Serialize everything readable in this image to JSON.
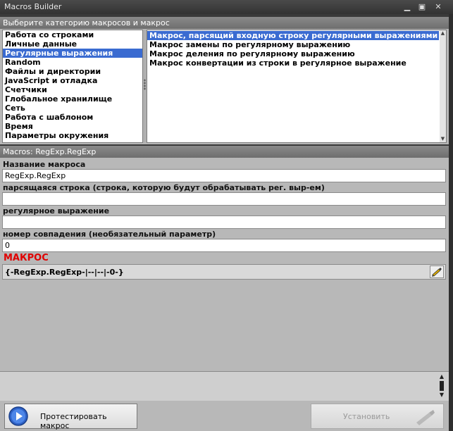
{
  "window": {
    "title": "Macros Builder"
  },
  "categories_panel": {
    "header": "Выберите категорию макросов и макрос",
    "categories": [
      "Работа со строками",
      "Личные данные",
      "Регулярные выражения",
      "Random",
      "Файлы и директории",
      "JavaScript и отладка",
      "Счетчики",
      "Глобальное хранилище",
      "Сеть",
      "Работа с шаблоном",
      "Время",
      "Параметры окружения"
    ],
    "selected_category": "Регулярные выражения",
    "macros": [
      "Макрос, парсящий входную строку регулярными выражениями",
      "Макрос замены по регулярному выражению",
      "Макрос деления по регулярному выражению",
      "Макрос конвертации из строки в регулярное выражение"
    ],
    "selected_macro": "Макрос, парсящий входную строку регулярными выражениями"
  },
  "macro_panel": {
    "header": "Macros: RegExp.RegExp",
    "fields": [
      {
        "label": "Название макроса",
        "value": "RegExp.RegExp"
      },
      {
        "label": "парсящаяся строка (строка, которую будут обрабатывать рег. выр-ем)",
        "value": ""
      },
      {
        "label": "регулярное выражение",
        "value": ""
      },
      {
        "label": "номер совпадения (необязательный параметр)",
        "value": "0"
      }
    ],
    "macro_label": "МАКРОС",
    "macro_text": "{-RegExp.RegExp-|--|--|-0-}"
  },
  "footer": {
    "test_button": "Протестировать макрос",
    "install_button": "Установить"
  },
  "colors": {
    "selection": "#3a6bd1",
    "macro_label": "#e00000"
  }
}
